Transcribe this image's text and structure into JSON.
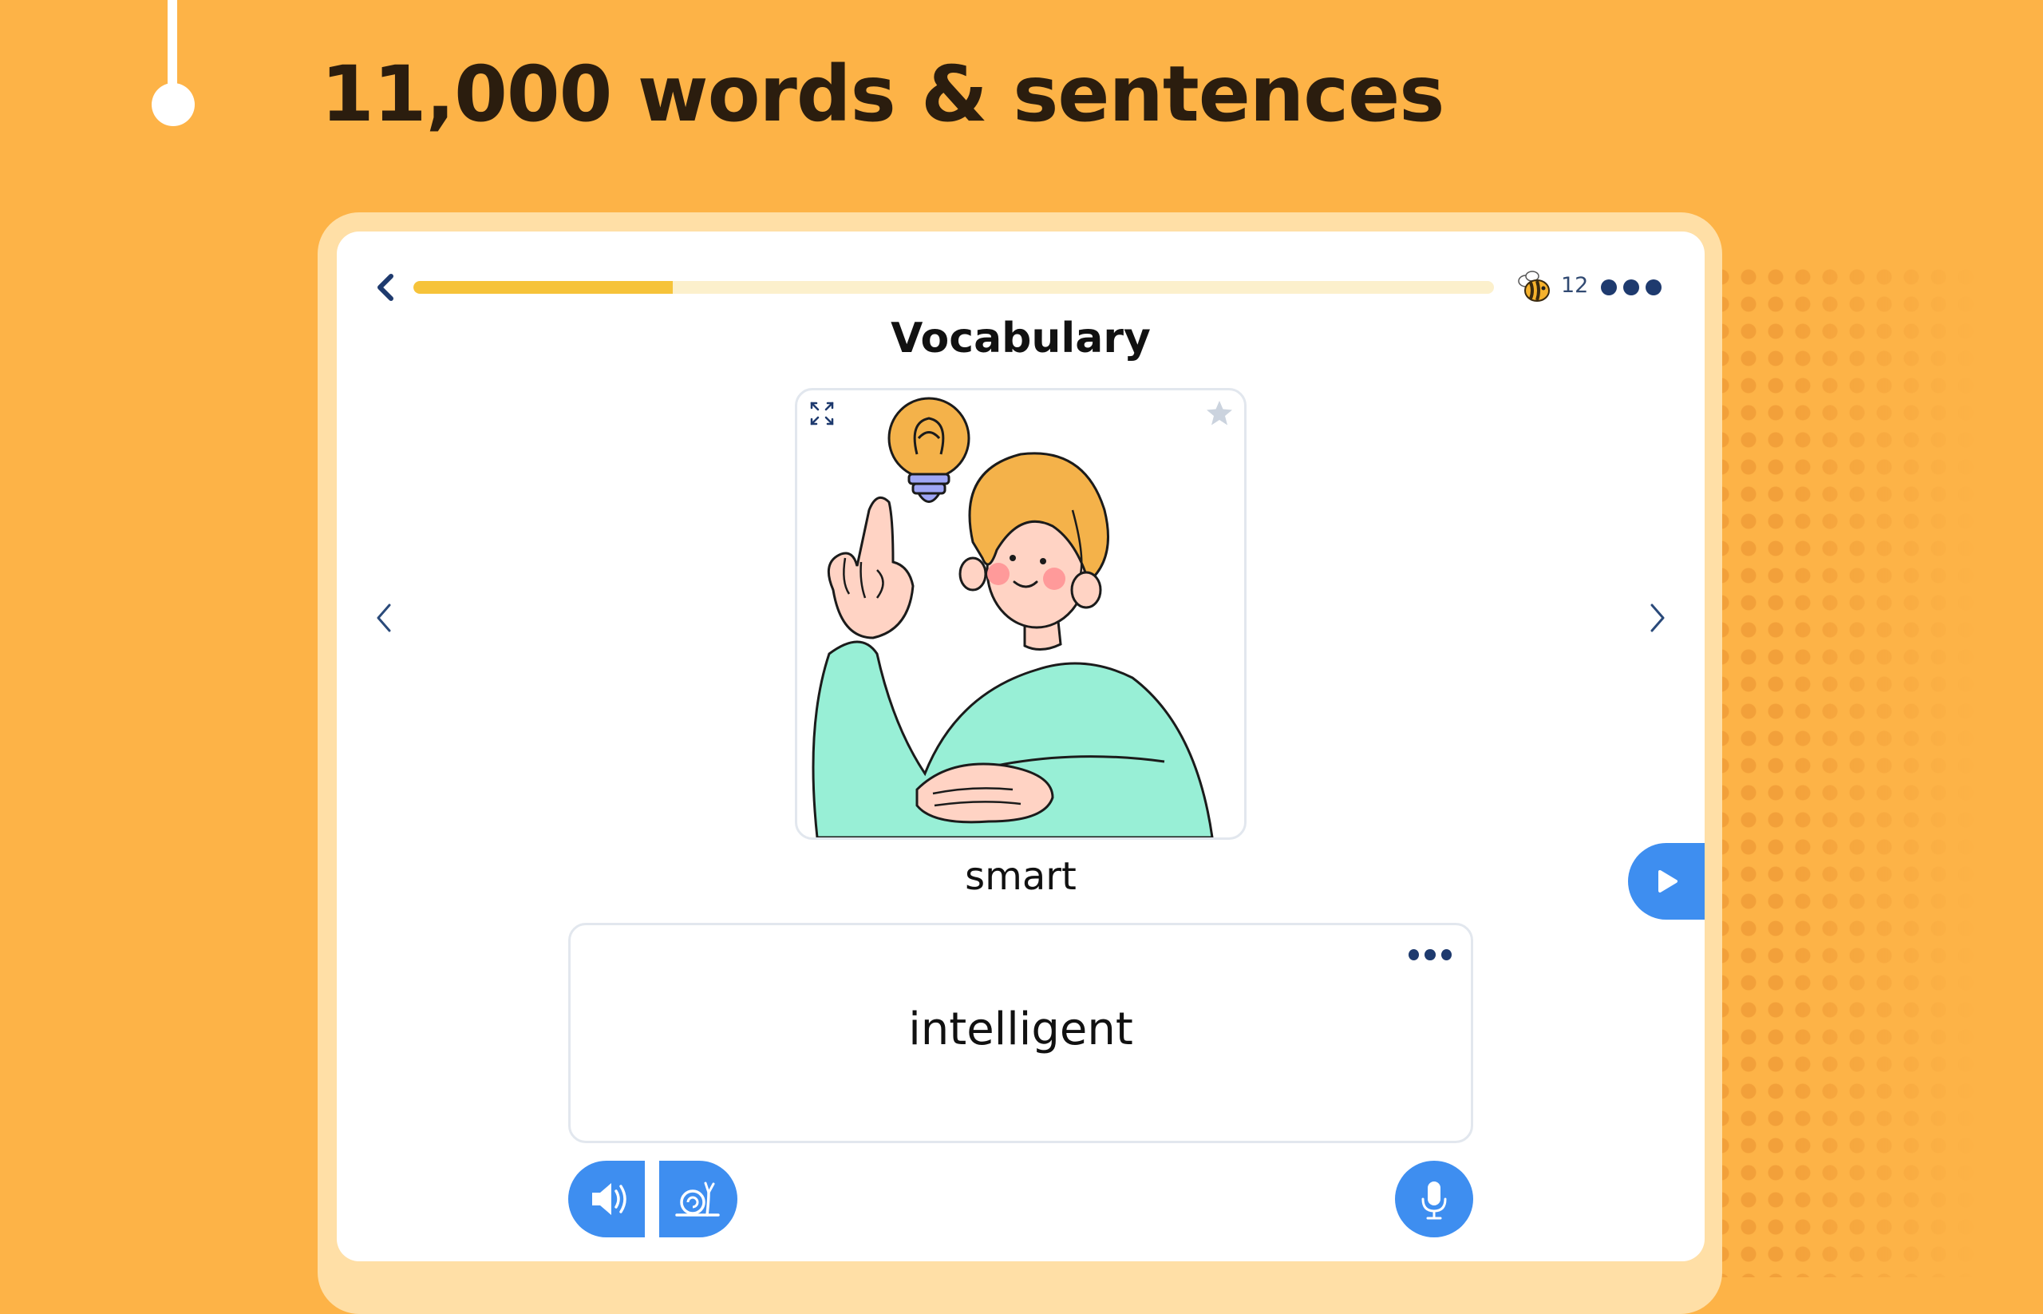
{
  "headline": "11,000 words & sentences",
  "header": {
    "progress": 0.24,
    "bee_count": "12",
    "icons": {
      "back": "chevron-left-icon",
      "bee": "bee-icon",
      "menu": "more-dots-icon"
    }
  },
  "lesson": {
    "title": "Vocabulary",
    "word": "smart",
    "answer": "intelligent",
    "image_subject": "person-with-idea-lightbulb"
  },
  "icons": {
    "expand": "expand-icon",
    "favorite": "star-icon",
    "prev": "chevron-left-icon",
    "next": "chevron-right-icon",
    "audio": "speaker-icon",
    "slow_audio": "snail-icon",
    "microphone": "microphone-icon",
    "play": "play-icon"
  },
  "colors": {
    "background": "#FDB347",
    "frame": "#FFDFA6",
    "accent_blue": "#3E8EF0",
    "progress_fill": "#F6C33A",
    "progress_track": "#FCF0CC",
    "title_dark": "#2B1D0E",
    "navy": "#1E3A6E"
  }
}
